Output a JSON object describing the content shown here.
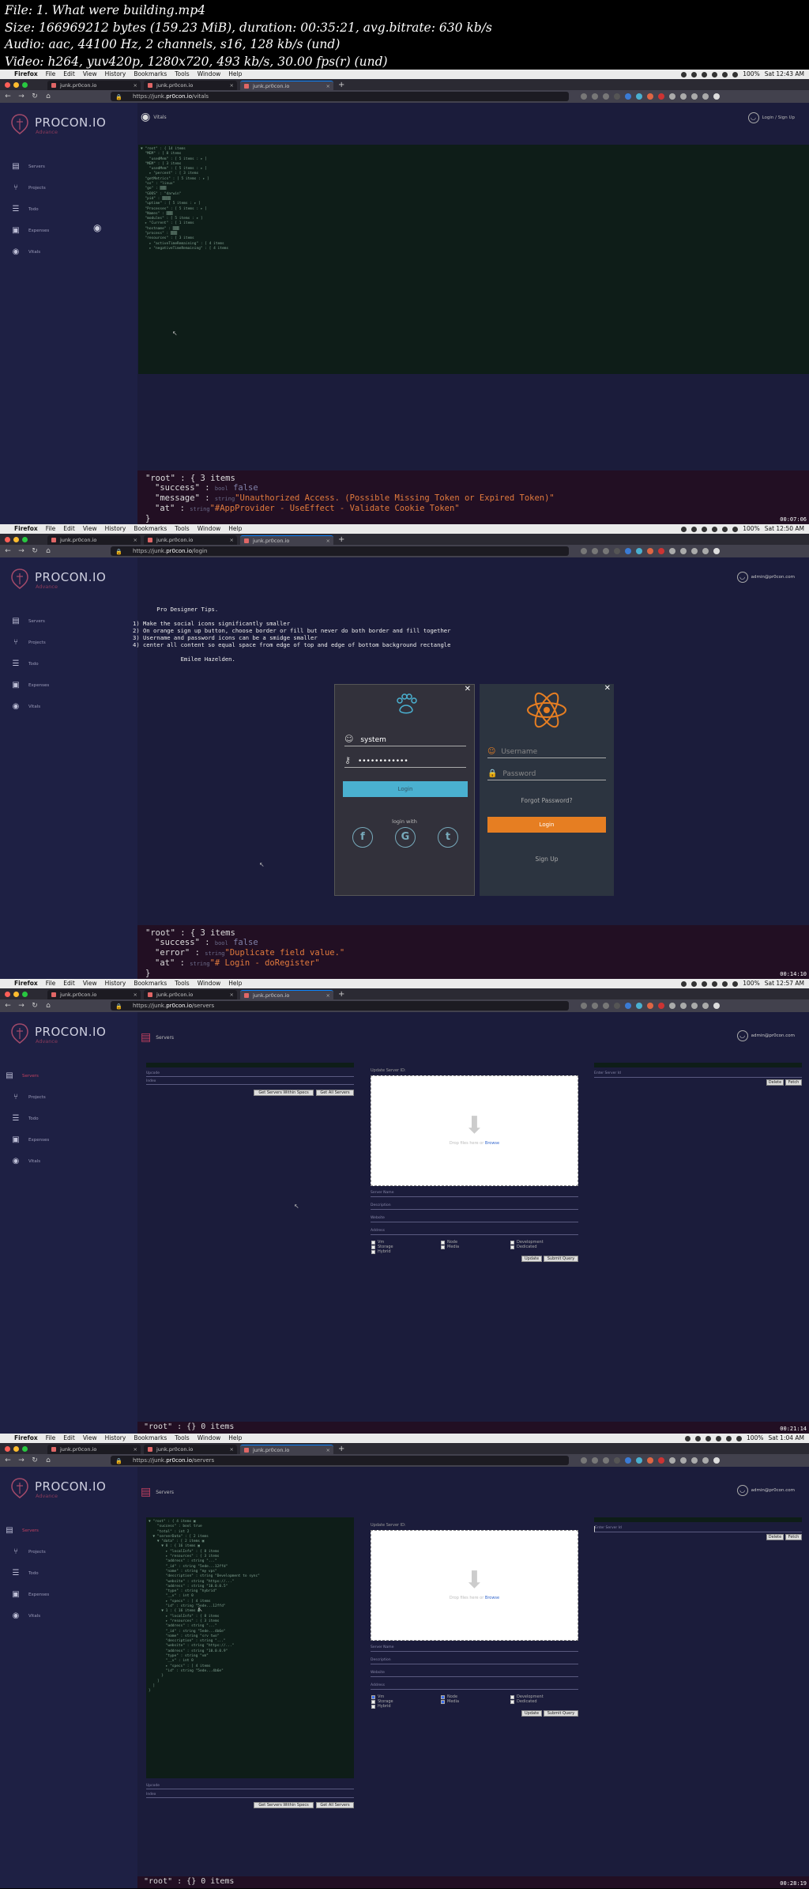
{
  "header": {
    "file": "File: 1. What were building.mp4",
    "size": "Size: 166969212 bytes (159.23 MiB), duration: 00:35:21, avg.bitrate: 630 kb/s",
    "audio": "Audio: aac, 44100 Hz, 2 channels, s16, 128 kb/s (und)",
    "video": "Video: h264, yuv420p, 1280x720, 493 kb/s, 30.00 fps(r) (und)"
  },
  "menubar": {
    "apple": "",
    "app": "Firefox",
    "items": [
      "File",
      "Edit",
      "View",
      "History",
      "Bookmarks",
      "Tools",
      "Window",
      "Help"
    ],
    "zoom": "100%"
  },
  "tabs": [
    "junk.pr0con.io",
    "junk.pr0con.io",
    "junk.pr0con.io"
  ],
  "brand": {
    "title": "PROCON.IO",
    "subtitle": "Advance"
  },
  "sidebar_items": [
    "Servers",
    "Projects",
    "Todo",
    "Expenses",
    "Vitals"
  ],
  "frames": [
    {
      "time": "Sat 12:43 AM",
      "url_prefix": "https://junk.",
      "url_host": "pr0con.io",
      "url_path": "/vitals",
      "page_label": "Vitals",
      "login_link": "Login / Sign Up",
      "json": {
        "root_label": "\"root\" : { 3 items",
        "type_bool": "bool",
        "type_str": "string",
        "k1": "\"success\"",
        "v1": "false",
        "k2": "\"message\"",
        "v2": "\"Unauthorized Access. (Possible Missing Token or Expired Token)\"",
        "k3": "\"at\"",
        "v3": "\"#AppProvider - UseEffect - Validate Cookie Token\"",
        "close": "}"
      },
      "timestamp": "00:07:06"
    },
    {
      "time": "Sat 12:50 AM",
      "url_prefix": "https://junk.",
      "url_host": "pr0con.io",
      "url_path": "/login",
      "user": "admin@pr0con.com",
      "tips": "       Pro Designer Tips.\n\n1) Make the social icons significantly smaller\n2) On orange sign up button, choose border or fill but never do both border and fill together\n3) Username and password icons can be a smidge smaller\n4) center all content so equal space from edge of top and edge of bottom background rectangle\n\n              Emilee Hazelden.",
      "login": {
        "username": "system",
        "password": "••••••••••••",
        "button": "Login",
        "login_with": "login with",
        "f": "f",
        "g": "G",
        "t": "t"
      },
      "signup": {
        "username_ph": "Username",
        "password_ph": "Password",
        "forgot": "Forgot Password?",
        "button": "Login",
        "signup": "Sign Up"
      },
      "json": {
        "root_label": "\"root\" : { 3 items",
        "type_bool": "bool",
        "type_str": "string",
        "k1": "\"success\"",
        "v1": "false",
        "k2": "\"error\"",
        "v2": "\"Duplicate field value.\"",
        "k3": "\"at\"",
        "v3": "\"# Login - doRegister\"",
        "close": "}"
      },
      "timestamp": "00:14:10"
    },
    {
      "time": "Sat 12:57 AM",
      "url_prefix": "https://junk.",
      "url_host": "pr0con.io",
      "url_path": "/servers",
      "page_label": "Servers",
      "user": "admin@pr0con.com",
      "json_root": "\"root\" : {} 0 items",
      "timestamp": "00:21:14"
    },
    {
      "time": "Sat 1:04 AM",
      "url_prefix": "https://junk.",
      "url_host": "pr0con.io",
      "url_path": "/servers",
      "page_label": "Servers",
      "user": "admin@pr0con.com",
      "json_root": "\"root\" : {} 0 items",
      "timestamp": "00:28:19"
    }
  ],
  "servers_form": {
    "update_title": "Update Server ID:",
    "upload_text": "Drop files here or",
    "browse": "Browse",
    "fields": [
      "Server Name",
      "Description",
      "Website",
      "Address"
    ],
    "checkboxes": [
      "Vm",
      "Storage",
      "Hybrid",
      "Node",
      "Media",
      "Development",
      "Dedicated",
      "Docker",
      "Shared"
    ],
    "update_btn": "Update",
    "submit_btn": "Submit Query",
    "get_within_btn": "Get Servers Within Specs",
    "get_all_btn": "Get All Servers",
    "search_label": "Upcode",
    "index_label": "Index",
    "enter_server": "Enter Server Id",
    "delete_btn": "Delete",
    "fetch_btn": "Fetch"
  },
  "colors": {
    "bg": "#1b1c3b",
    "sidebar": "#1e2044",
    "orange": "#e67e22",
    "cyan": "#4ab0d0"
  }
}
